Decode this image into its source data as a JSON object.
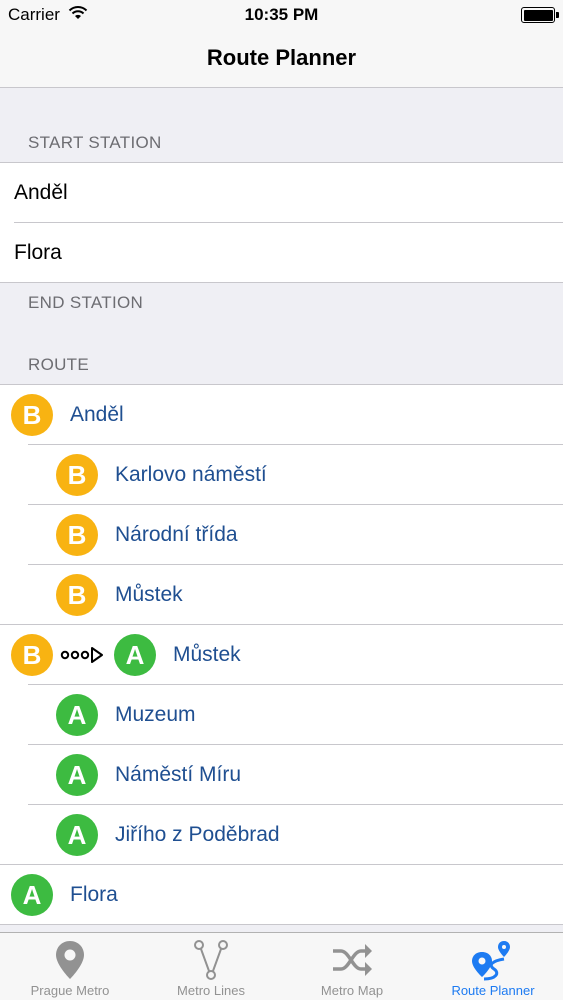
{
  "status_bar": {
    "carrier": "Carrier",
    "time": "10:35 PM"
  },
  "nav": {
    "title": "Route Planner"
  },
  "start_section": {
    "header": "START STATION",
    "options": [
      "Anděl",
      "Flora"
    ]
  },
  "end_section": {
    "header": "END STATION"
  },
  "route_section": {
    "header": "ROUTE",
    "stops": [
      {
        "line": "B",
        "station": "Anděl"
      },
      {
        "line": "B",
        "station": "Karlovo náměstí"
      },
      {
        "line": "B",
        "station": "Národní třída"
      },
      {
        "line": "B",
        "station": "Můstek"
      },
      {
        "line": "A",
        "from_line": "B",
        "station": "Můstek"
      },
      {
        "line": "A",
        "station": "Muzeum"
      },
      {
        "line": "A",
        "station": "Náměstí Míru"
      },
      {
        "line": "A",
        "station": "Jiřího z Poděbrad"
      },
      {
        "line": "A",
        "station": "Flora"
      }
    ]
  },
  "tabs": [
    {
      "label": "Prague Metro",
      "icon": "location-pin-icon"
    },
    {
      "label": "Metro Lines",
      "icon": "lines-icon"
    },
    {
      "label": "Metro Map",
      "icon": "shuffle-icon"
    },
    {
      "label": "Route Planner",
      "icon": "route-icon",
      "active": true
    }
  ],
  "colors": {
    "line_a": "#3dbb41",
    "line_b": "#f8b312",
    "tint": "#1d7bf2",
    "route_text": "#1f4f91"
  }
}
